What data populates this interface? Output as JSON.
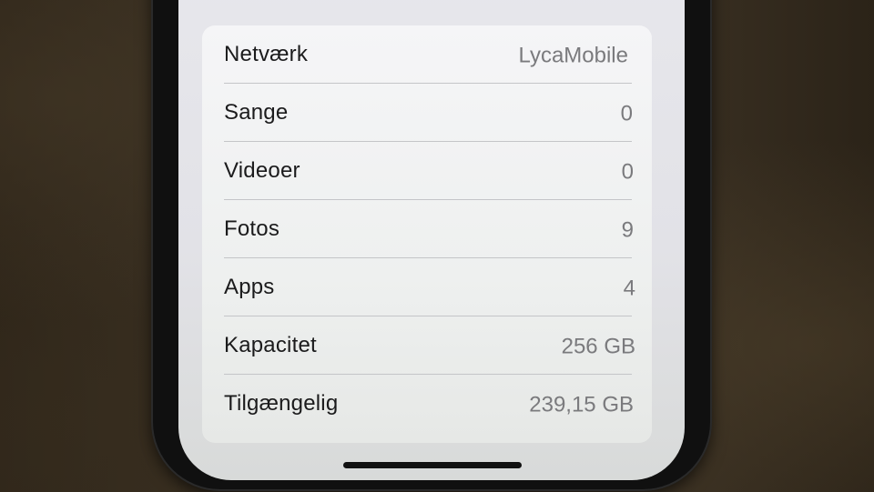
{
  "about": {
    "rows": [
      {
        "label": "Netværk",
        "value": "LycaMobile"
      },
      {
        "label": "Sange",
        "value": "0"
      },
      {
        "label": "Videoer",
        "value": "0"
      },
      {
        "label": "Fotos",
        "value": "9"
      },
      {
        "label": "Apps",
        "value": "4"
      },
      {
        "label": "Kapacitet",
        "value": "256 GB"
      },
      {
        "label": "Tilgængelig",
        "value": "239,15 GB"
      }
    ]
  },
  "colors": {
    "screen_bg": "#e4e4e9",
    "card_bg": "#f3f3f5",
    "label_text": "#1b1b1c",
    "value_text": "#7a7a7d",
    "surface": "#35291d"
  }
}
